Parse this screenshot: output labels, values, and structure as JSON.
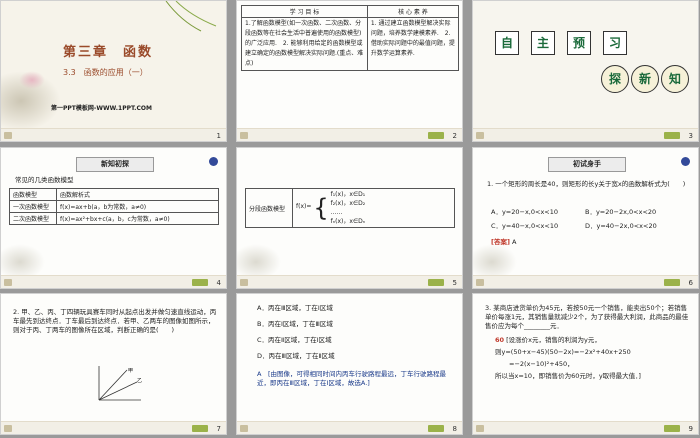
{
  "slides": [
    {
      "number": "1",
      "chapter": "第三章　函数",
      "section": "3.3　函数的应用（一）",
      "source": "第一PPT模板网-WWW.1PPT.COM"
    },
    {
      "number": "2",
      "header_left": "学 习 目 标",
      "header_right": "核 心 素 养",
      "left_text": "1.了解函数模型(如一次函数、二次函数、分段函数等在社会生活中普遍使用的函数模型)的广泛应用.　2. 能够利用给定的函数模型或建立确定的函数模型解决实际问题.(重点、难点)",
      "right_text": "1. 通过建立函数模型解决实际问题，培养数学建模素养.　2. 借助实际问题中的最值问题，提升数学运算素养."
    },
    {
      "number": "3",
      "chars_top": [
        "自",
        "主",
        "预",
        "习"
      ],
      "chars_bottom": [
        "探",
        "新",
        "知"
      ]
    },
    {
      "number": "4",
      "caption": "新知初探",
      "title": "常见的几类函数模型",
      "table_headers": [
        "函数模型",
        "函数解析式"
      ],
      "table_rows": [
        [
          "一次函数模型",
          "f(x)=ax+b(a，b为常数，a≠0)"
        ],
        [
          "二次函数模型",
          "f(x)=ax²+bx+c(a，b，c为常数，a≠0)"
        ]
      ]
    },
    {
      "number": "5",
      "label": "分段函数模型",
      "fx": "f(x)=",
      "cases": [
        "f₁(x)，x∈D₁",
        "f₂(x)，x∈D₂",
        "……",
        "fₙ(x)，x∈Dₙ"
      ]
    },
    {
      "number": "6",
      "caption": "初试身手",
      "question": "1. 一个矩形的周长是40，则矩形的长y关于宽x的函数解析式为(　　)",
      "options": [
        "A．y=20−x,0<x<10",
        "B．y=20−2x,0<x<20",
        "C．y=40−x,0<x<10",
        "D．y=40−2x,0<x<20"
      ],
      "answer_label": "[答案]",
      "answer": "A"
    },
    {
      "number": "7",
      "question": "2. 甲、乙、丙、丁四辆玩具赛车同时从起点出发并做匀速直线运动，丙车最先到达终点．丁车最后到达终点．若甲、乙两车的图像如图所示，则对于丙、丁两车的图像所在区域，判断正确的是(　　)",
      "graph_labels": [
        "甲",
        "乙"
      ]
    },
    {
      "number": "8",
      "options": [
        "A．丙在Ⅲ区域，丁在Ⅰ区域",
        "B．丙在Ⅰ区域，丁在Ⅲ区域",
        "C．丙在Ⅱ区域，丁在Ⅰ区域",
        "D．丙在Ⅲ区域，丁在Ⅱ区域"
      ],
      "explanation": "A　[由图像，可得相同时间内丙车行驶路程最远，丁车行驶路程最近，即丙在Ⅲ区域，丁在Ⅰ区域，故选A.]"
    },
    {
      "number": "9",
      "question": "3. 某商店进货单价为45元，若按50元一个销售，能卖出50个；若销售单价每涨1元，其销售量就减少2个，为了获得最大利润，此商品的最佳售价应为每个________元．",
      "answer_value": "60",
      "solution_1": "[设涨价x元，销售的利润为y元，",
      "solution_2": "则y=(50+x−45)(50−2x)=−2x²+40x+250",
      "solution_3": "=−2(x−10)²+450，",
      "solution_4": "所以当x=10，即销售价为60元时，y取得最大值．]"
    }
  ]
}
